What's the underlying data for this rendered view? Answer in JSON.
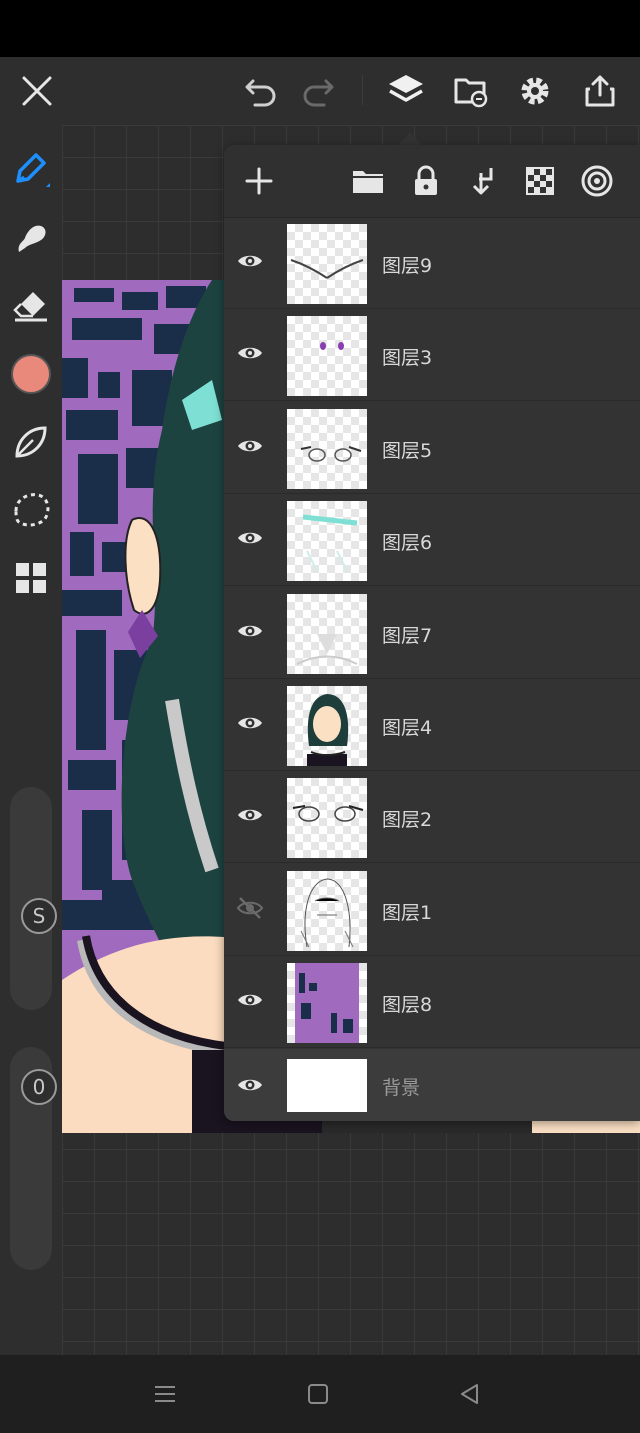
{
  "toolbar": {
    "close": "close-icon",
    "undo": "undo-icon",
    "redo": "redo-icon",
    "layers": "layers-icon",
    "gallery": "gallery-icon",
    "settings": "gear-icon",
    "export": "share-icon"
  },
  "tools": {
    "brush_color": "#e8897b",
    "size_label": "S",
    "opacity_label": "0"
  },
  "colors": {
    "accent": "#1e8fff",
    "panel": "#333333",
    "canvas_bg": "#2d2d2d"
  },
  "layers_panel": {
    "actions": [
      "add-layer-icon",
      "folder-icon",
      "lock-icon",
      "merge-down-icon",
      "transparency-icon",
      "blend-mode-icon"
    ],
    "layers": [
      {
        "name": "图层9",
        "visible": true
      },
      {
        "name": "图层3",
        "visible": true
      },
      {
        "name": "图层5",
        "visible": true
      },
      {
        "name": "图层6",
        "visible": true
      },
      {
        "name": "图层7",
        "visible": true
      },
      {
        "name": "图层4",
        "visible": true
      },
      {
        "name": "图层2",
        "visible": true
      },
      {
        "name": "图层1",
        "visible": false
      },
      {
        "name": "图层8",
        "visible": true
      },
      {
        "name": "背景",
        "visible": true,
        "selected": true
      }
    ]
  },
  "navbar": {
    "menu": "menu-icon",
    "home": "home-icon",
    "back": "back-icon"
  }
}
